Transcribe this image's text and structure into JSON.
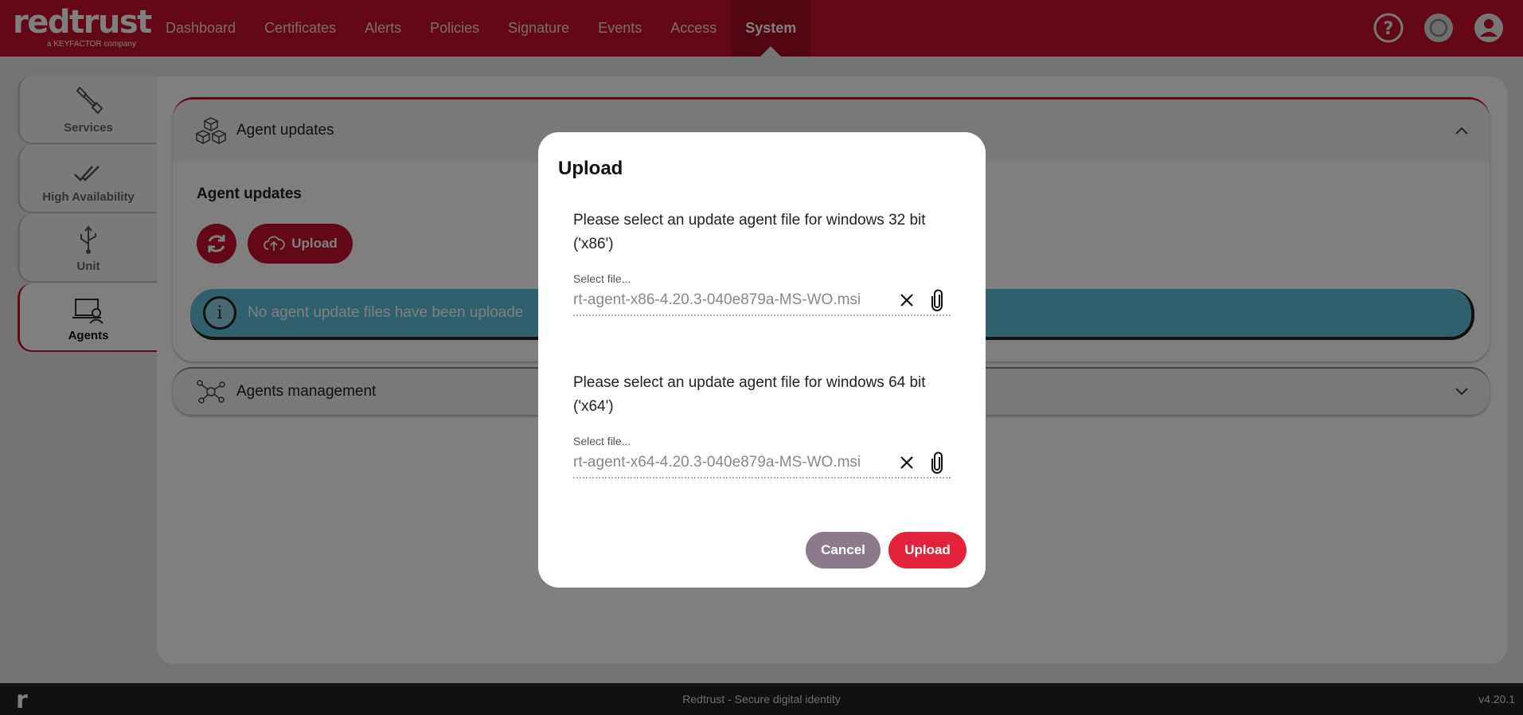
{
  "brand": {
    "logo_text": "redtrust",
    "logo_sub": "a KEYFACTOR company"
  },
  "nav": {
    "items": [
      {
        "label": "Dashboard"
      },
      {
        "label": "Certificates"
      },
      {
        "label": "Alerts"
      },
      {
        "label": "Policies"
      },
      {
        "label": "Signature"
      },
      {
        "label": "Events"
      },
      {
        "label": "Access"
      },
      {
        "label": "System"
      }
    ],
    "active": "System"
  },
  "sidebar": {
    "items": [
      {
        "label": "Services",
        "icon": "wrench-icon"
      },
      {
        "label": "High Availability",
        "icon": "double-check-icon"
      },
      {
        "label": "Unit",
        "icon": "usb-icon"
      },
      {
        "label": "Agents",
        "icon": "agent-laptop-icon"
      }
    ],
    "active": "Agents"
  },
  "main": {
    "agent_updates_header": "Agent updates",
    "agent_updates_subtitle": "Agent updates",
    "upload_button": "Upload",
    "alert_text": "No agent update files have been uploade",
    "agents_management_header": "Agents management"
  },
  "modal": {
    "title": "Upload",
    "field_x86": {
      "label": "Please select an update agent file for windows 32 bit ('x86')",
      "hint": "Select file...",
      "value": "rt-agent-x86-4.20.3-040e879a-MS-WO.msi"
    },
    "field_x64": {
      "label": "Please select an update agent file for windows 64 bit ('x64')",
      "hint": "Select file...",
      "value": "rt-agent-x64-4.20.3-040e879a-MS-WO.msi"
    },
    "cancel_label": "Cancel",
    "upload_label": "Upload"
  },
  "footer": {
    "text": "Redtrust - Secure digital identity",
    "version": "v4.20.1",
    "mark": "r"
  },
  "colors": {
    "brand_red": "#c8102e",
    "info_blue": "#5fc0d6",
    "cancel_mauve": "#8c7a8c"
  }
}
